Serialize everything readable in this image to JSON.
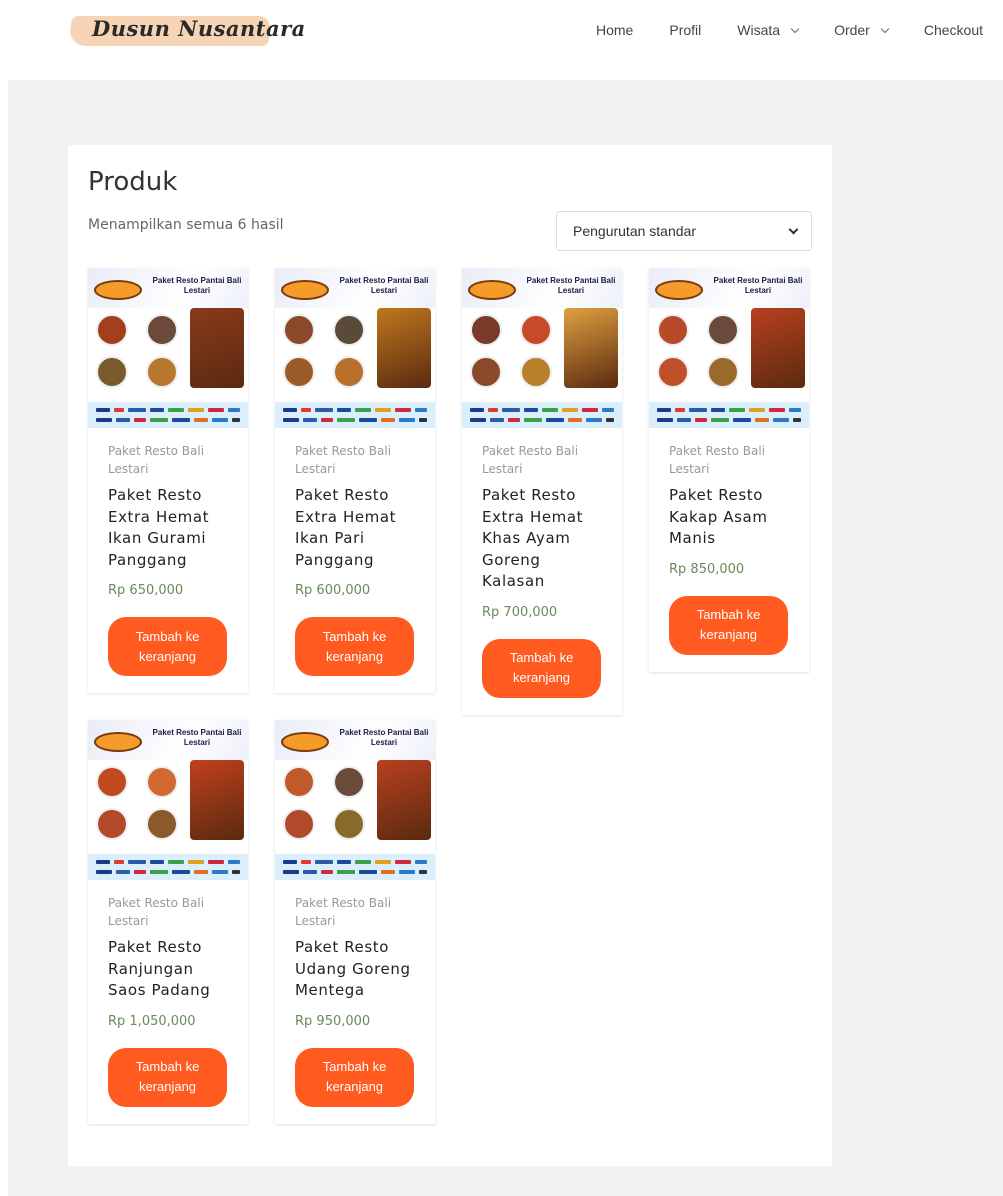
{
  "header": {
    "logo_text": "Dusun Nusantara",
    "nav": [
      {
        "label": "Home"
      },
      {
        "label": "Profil"
      },
      {
        "label": "Wisata"
      },
      {
        "label": "Order"
      },
      {
        "label": "Checkout"
      }
    ]
  },
  "shop": {
    "title": "Produk",
    "result_count": "Menampilkan semua 6 hasil",
    "ordering": {
      "selected": "Pengurutan standar"
    },
    "thumb_heading": "Paket Resto Pantai Bali Lestari",
    "products": [
      {
        "category": "Paket Resto Bali Lestari",
        "name": "Paket Resto Extra Hemat Ikan Gurami Panggang",
        "price": "Rp 650,000",
        "button": "Tambah ke keranjang"
      },
      {
        "category": "Paket Resto Bali Lestari",
        "name": "Paket Resto Extra Hemat Ikan Pari Panggang",
        "price": "Rp 600,000",
        "button": "Tambah ke keranjang"
      },
      {
        "category": "Paket Resto Bali Lestari",
        "name": "Paket Resto Extra Hemat Khas Ayam Goreng Kalasan",
        "price": "Rp 700,000",
        "button": "Tambah ke keranjang"
      },
      {
        "category": "Paket Resto Bali Lestari",
        "name": "Paket Resto Kakap Asam Manis",
        "price": "Rp 850,000",
        "button": "Tambah ke keranjang"
      },
      {
        "category": "Paket Resto Bali Lestari",
        "name": "Paket Resto Ranjungan Saos Padang",
        "price": "Rp 1,050,000",
        "button": "Tambah ke keranjang"
      },
      {
        "category": "Paket Resto Bali Lestari",
        "name": "Paket Resto Udang Goreng Mentega",
        "price": "Rp 950,000",
        "button": "Tambah ke keranjang"
      }
    ]
  },
  "colors": {
    "accent": "#ff5a1f",
    "price": "#6a8a5a",
    "background": "#f2f2f2"
  }
}
